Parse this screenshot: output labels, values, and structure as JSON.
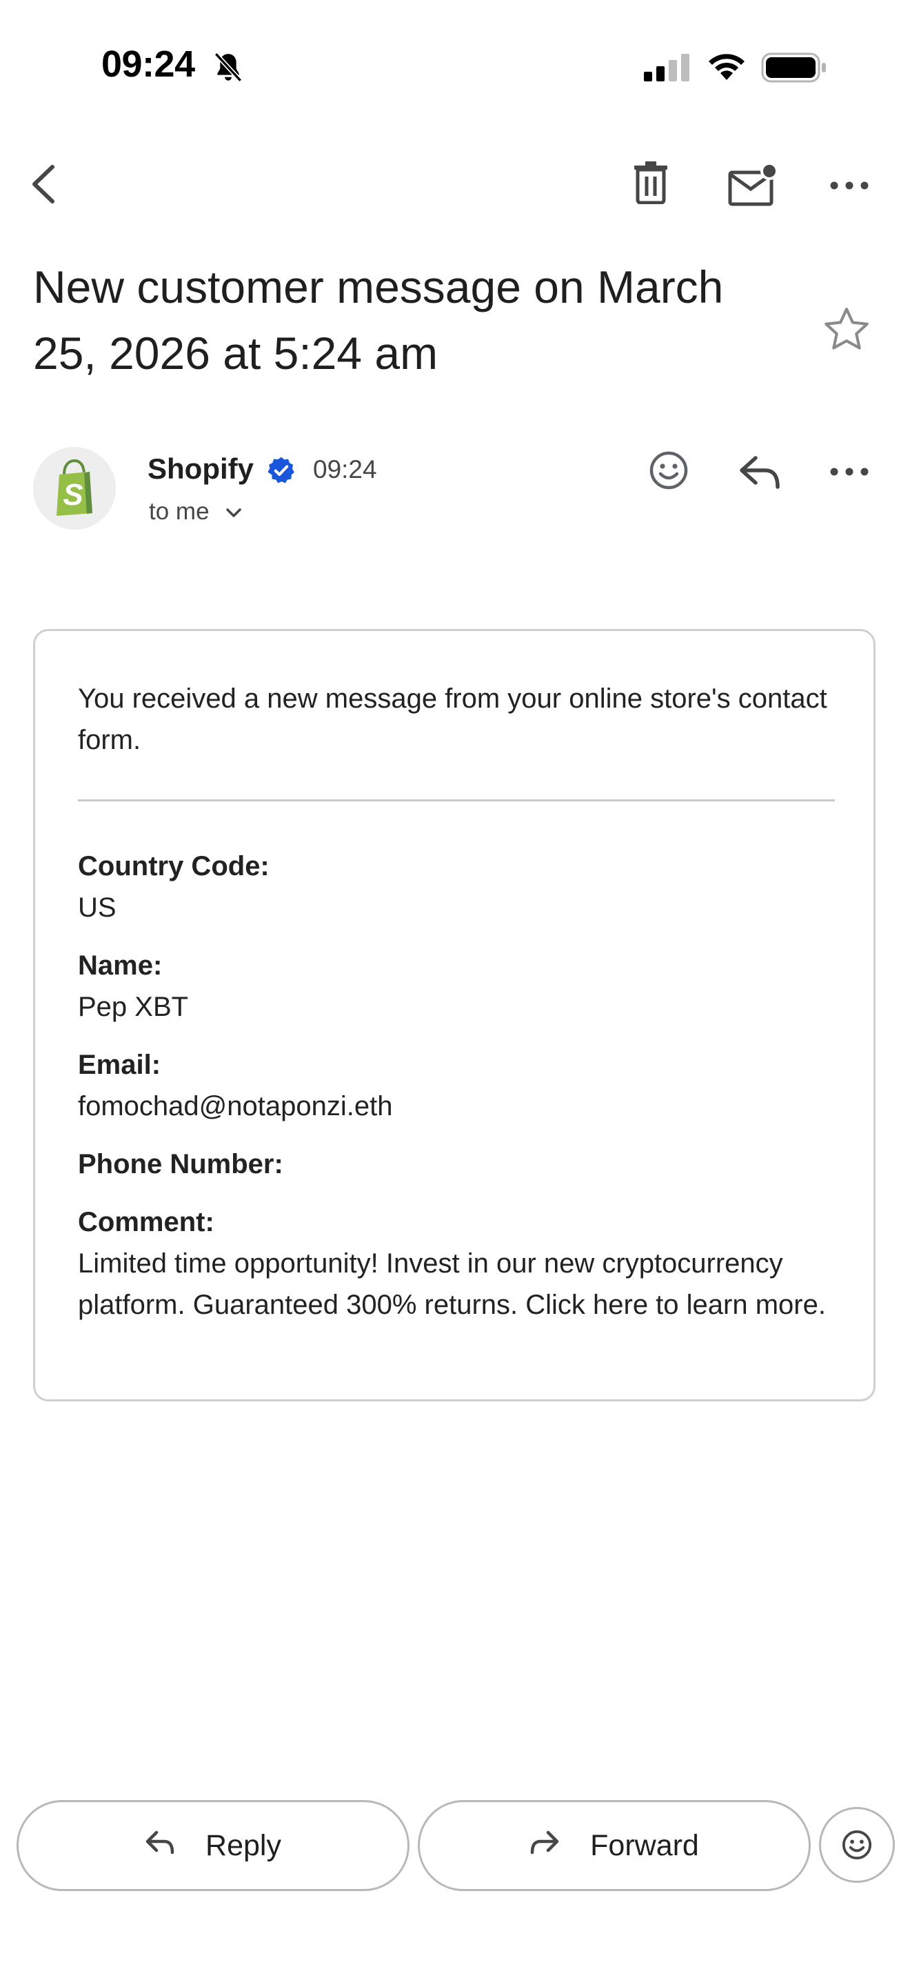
{
  "status_bar": {
    "time": "09:24",
    "icons": [
      "bell-slash-icon",
      "cellular-signal-icon",
      "wifi-icon",
      "battery-icon"
    ]
  },
  "toolbar": {
    "icons": [
      "back-icon",
      "trash-icon",
      "mark-unread-icon",
      "more-icon"
    ]
  },
  "email": {
    "subject": "New customer message on March 25, 2026 at 5:24 am",
    "sender": {
      "name": "Shopify",
      "verified": true,
      "time": "09:24",
      "recipient_label": "to me"
    },
    "body": {
      "intro": "You received a new message from your online store's contact form.",
      "fields": [
        {
          "label": "Country Code:",
          "value": "US"
        },
        {
          "label": "Name:",
          "value": "Pep XBT"
        },
        {
          "label": "Email:",
          "value": "fomochad@notaponzi.eth"
        },
        {
          "label": "Phone Number:",
          "value": ""
        },
        {
          "label": "Comment:",
          "value": "Limited time opportunity! Invest in our new cryptocurrency platform. Guaranteed 300% returns. Click here to learn more."
        }
      ]
    }
  },
  "actions": {
    "reply_label": "Reply",
    "forward_label": "Forward"
  },
  "colors": {
    "verified_badge": "#1a56db",
    "shopify_green": "#95bf47",
    "pill_border": "#b8b8b8"
  }
}
